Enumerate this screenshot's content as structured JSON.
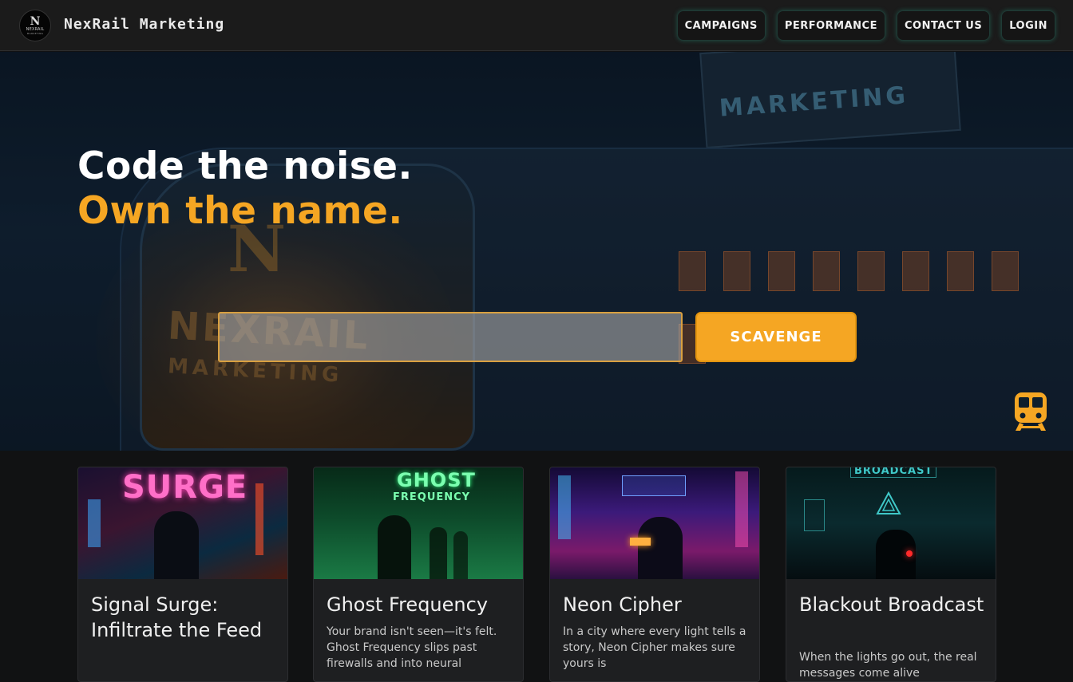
{
  "header": {
    "logo_letter": "N",
    "logo_line1": "NEXRAIL",
    "logo_line2": "MARKETING",
    "brand": "NexRail Marketing",
    "nav": [
      "CAMPAIGNS",
      "PERFORMANCE",
      "CONTACT US",
      "LOGIN"
    ]
  },
  "hero": {
    "headline_1": "Code the noise.",
    "headline_2": "Own the name.",
    "search": {
      "value": "",
      "placeholder": ""
    },
    "button_label": "SCAVENGE",
    "bg_sign_text": "MARKETING",
    "bg_badge_letter": "N",
    "bg_logo_line1": "NEXRAIL",
    "bg_logo_line2": "MARKETING"
  },
  "cards": [
    {
      "title": "Signal Surge: Infiltrate the Feed",
      "desc": "",
      "image_text_1": "SURGE",
      "image_text_2": ""
    },
    {
      "title": "Ghost Frequency",
      "desc": "Your brand isn't seen—it's felt. Ghost Frequency slips past firewalls and into neural",
      "image_text_1": "GHOST",
      "image_text_2": "FREQUENCY"
    },
    {
      "title": "Neon Cipher",
      "desc": "In a city where every light tells a story, Neon Cipher makes sure yours is",
      "image_text_1": "",
      "image_text_2": ""
    },
    {
      "title": "Blackout Broadcast",
      "desc": "When the lights go out, the real messages come alive",
      "image_text_1": "BROADCAST",
      "image_text_2": ""
    }
  ],
  "colors": {
    "accent": "#f5a623",
    "header_bg": "#1b1b1b",
    "page_bg": "#111213",
    "nav_glow": "#28b496"
  },
  "icons": [
    "train-icon"
  ]
}
